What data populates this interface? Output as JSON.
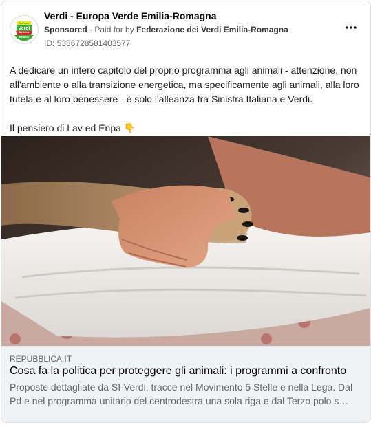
{
  "post": {
    "page_name": "Verdi - Europa Verde Emilia-Romagna",
    "sponsored_label": "Sponsored",
    "paid_for_prefix": "Paid for by",
    "paid_for_org": "Federazione dei Verdi Emilia-Romagna",
    "ad_id": "ID: 538672858140357 7",
    "more_icon": "more-horizontal-icon",
    "text_paragraph_1": "A dedicare un intero capitolo del proprio programma agli animali - attenzione, non all'ambiente o alla transizione energetica, ma specificamente agli animali, alla loro tutela e al loro benessere - è solo l'alleanza fra Sinistra Italiana e Verdi.",
    "text_paragraph_2": "Il pensiero di Lav ed Enpa 👇"
  },
  "avatar": {
    "logo_text_1": "Europa",
    "logo_text_2": "Verdi",
    "logo_text_3": "Sinistra",
    "logo_text_4": "Italiana"
  },
  "link": {
    "domain": "REPUBBLICA.IT",
    "title": "Cosa fa la politica per proteggere gli animali: i programmi a confronto",
    "description": "Proposte dettagliate da SI-Verdi, tracce nel Movimento 5 Stelle e nella Lega. Dal Pd e nel programma unitario del centrodestra una sola riga e dal Terzo polo s…"
  },
  "colors": {
    "accent_green": "#3aa935",
    "accent_red": "#d7262e",
    "text_secondary": "#65676b"
  }
}
